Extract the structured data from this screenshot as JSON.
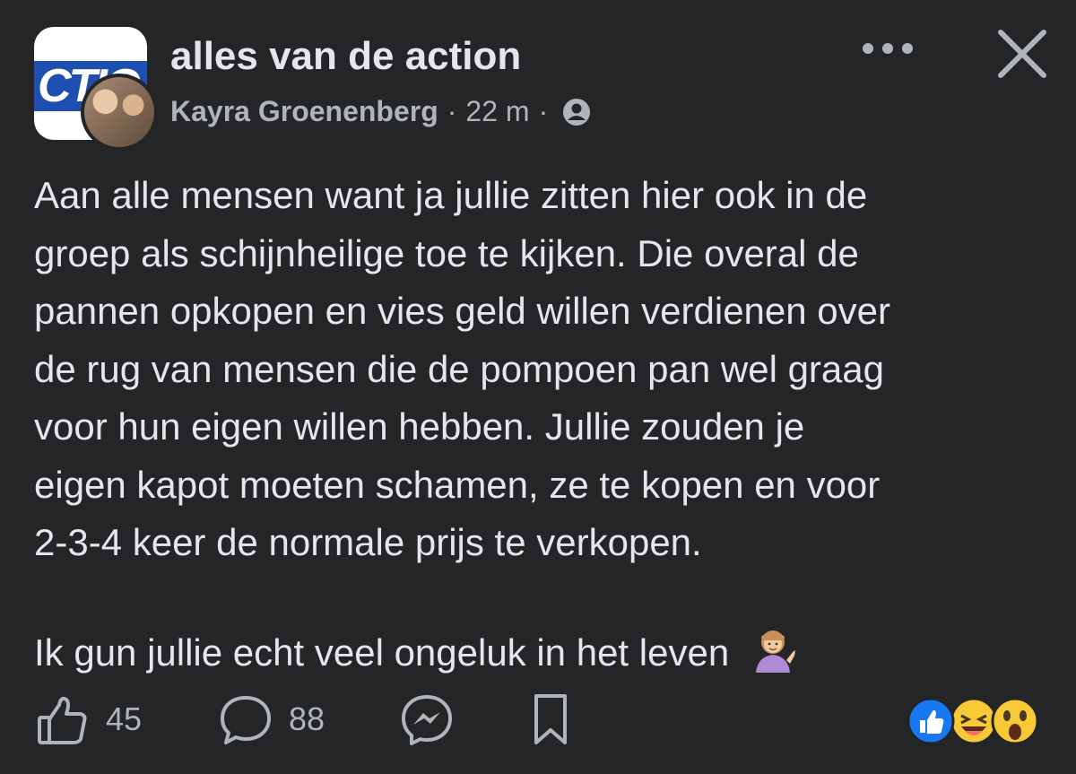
{
  "header": {
    "group_name": "alles van de action",
    "author": "Kayra Groenenberg",
    "separator": "·",
    "time": "22 m",
    "logo_text": "CTIO",
    "icons": {
      "privacy": "people-icon",
      "more": "more-dots-icon",
      "close": "close-icon"
    }
  },
  "post": {
    "lines": [
      "Aan alle mensen want ja jullie zitten hier ook in de",
      "groep als schijnheilige toe te kijken. Die overal de",
      "pannen opkopen en vies geld willen verdienen over",
      "de rug van mensen die de pompoen pan wel graag",
      "voor hun eigen willen hebben. Jullie zouden je",
      "eigen kapot moeten schamen, ze te kopen en voor",
      "2-3-4 keer de normale prijs te verkopen."
    ],
    "closing": "Ik gun jullie echt veel ongeluk in het leven",
    "closing_emoji": "person-tipping-hand-emoji"
  },
  "actions": {
    "likes": "45",
    "comments": "88",
    "icons": [
      "thumbs-up-icon",
      "comment-icon",
      "messenger-icon",
      "bookmark-icon"
    ]
  },
  "reactions": [
    "like",
    "laugh",
    "wow"
  ],
  "colors": {
    "background": "#242526",
    "text": "#e4e6eb",
    "secondary": "#b0b3b8",
    "like_blue": "#1877f2",
    "emoji_yellow": "#f7c935"
  }
}
